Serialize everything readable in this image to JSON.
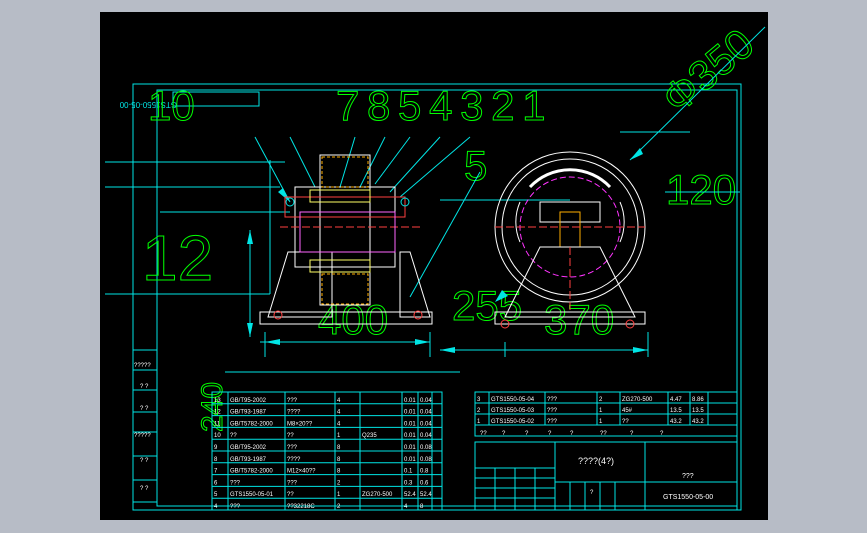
{
  "drawing": {
    "code_box": "GTS1550-05-00",
    "top_dims": {
      "d10": "10",
      "seq": "7 8 5 4 3 2 1",
      "phi": "Φ350"
    },
    "dims": {
      "d5": "5",
      "d120": "120",
      "d12": "12",
      "d400": "400",
      "d255": "255",
      "d370": "370",
      "d240": "240"
    }
  },
  "bom_left": [
    {
      "no": "13",
      "code": "GB/T95-2002",
      "name": "???",
      "qty": "4",
      "mat": "",
      "w1": "0.01",
      "w2": "0.04"
    },
    {
      "no": "12",
      "code": "GB/T93-1987",
      "name": "????",
      "qty": "4",
      "mat": "",
      "w1": "0.01",
      "w2": "0.04"
    },
    {
      "no": "11",
      "code": "GB/T5782-2000",
      "name": "M8×20??",
      "qty": "4",
      "mat": "",
      "w1": "0.01",
      "w2": "0.04"
    },
    {
      "no": "10",
      "code": "??",
      "name": "??",
      "qty": "1",
      "mat": "Q235",
      "w1": "0.01",
      "w2": "0.04"
    },
    {
      "no": "9",
      "code": "GB/T95-2002",
      "name": "???",
      "qty": "8",
      "mat": "",
      "w1": "0.01",
      "w2": "0.08"
    },
    {
      "no": "8",
      "code": "GB/T93-1987",
      "name": "????",
      "qty": "8",
      "mat": "",
      "w1": "0.01",
      "w2": "0.08"
    },
    {
      "no": "7",
      "code": "GB/T5782-2000",
      "name": "M12×40??",
      "qty": "8",
      "mat": "",
      "w1": "0.1",
      "w2": "0.8"
    },
    {
      "no": "6",
      "code": "???",
      "name": "???",
      "qty": "2",
      "mat": "",
      "w1": "0.3",
      "w2": "0.6"
    },
    {
      "no": "5",
      "code": "GTS1550-05-01",
      "name": "??",
      "qty": "1",
      "mat": "ZG270-500",
      "w1": "52.4",
      "w2": "52.4"
    },
    {
      "no": "4",
      "code": "???",
      "name": "??32218C",
      "qty": "2",
      "mat": "",
      "w1": "4",
      "w2": "8"
    }
  ],
  "bom_right": [
    {
      "no": "3",
      "code": "GTS1550-05-04",
      "name": "???",
      "qty": "2",
      "mat": "ZG270-500",
      "w1": "4.47",
      "w2": "8.86"
    },
    {
      "no": "2",
      "code": "GTS1550-05-03",
      "name": "???",
      "qty": "1",
      "mat": "45#",
      "w1": "13.5",
      "w2": "13.5"
    },
    {
      "no": "1",
      "code": "GTS1550-05-02",
      "name": "???",
      "qty": "1",
      "mat": "??",
      "w1": "43.2",
      "w2": "43.2"
    }
  ],
  "bom_header": [
    "??",
    "?",
    "?",
    "?",
    "?",
    "??",
    "?",
    "?"
  ],
  "side_labels": [
    "?????",
    "? ?",
    "? ?",
    "?????",
    "? ?",
    "? ?"
  ],
  "title_block": {
    "main": "????(4?)",
    "name_cell": "???",
    "code": "GTS1550-05-00",
    "small": [
      "?",
      "??",
      "?",
      "?",
      "??",
      "??",
      "??"
    ],
    "scale": "?"
  }
}
